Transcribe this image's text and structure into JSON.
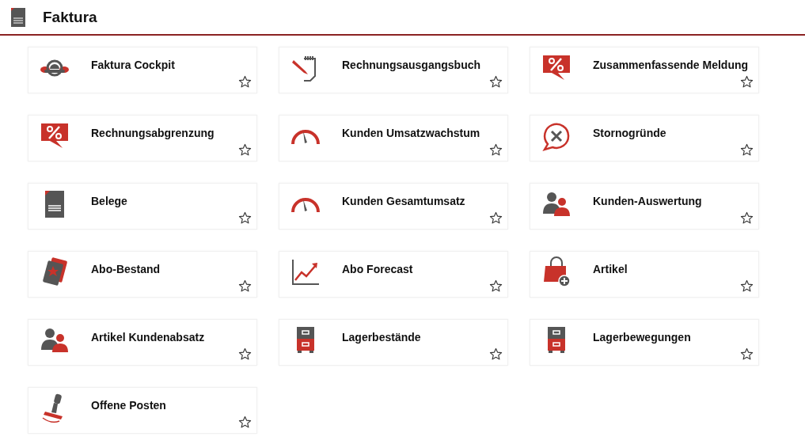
{
  "header": {
    "title": "Faktura"
  },
  "tiles": [
    {
      "label": "Faktura Cockpit",
      "kind": "cockpit"
    },
    {
      "label": "Rechnungsausgangsbuch",
      "kind": "notebook"
    },
    {
      "label": "Zusammenfassende Meldung",
      "kind": "percent"
    },
    {
      "label": "Rechnungsabgrenzung",
      "kind": "percent"
    },
    {
      "label": "Kunden Umsatzwachstum",
      "kind": "gauge"
    },
    {
      "label": "Stornogründe",
      "kind": "cancel"
    },
    {
      "label": "Belege",
      "kind": "document"
    },
    {
      "label": "Kunden Gesamtumsatz",
      "kind": "gauge"
    },
    {
      "label": "Kunden-Auswertung",
      "kind": "users"
    },
    {
      "label": "Abo-Bestand",
      "kind": "card"
    },
    {
      "label": "Abo Forecast",
      "kind": "chart"
    },
    {
      "label": "Artikel",
      "kind": "bag"
    },
    {
      "label": "Artikel Kundenabsatz",
      "kind": "users"
    },
    {
      "label": "Lagerbestände",
      "kind": "cabinet"
    },
    {
      "label": "Lagerbewegungen",
      "kind": "cabinet"
    },
    {
      "label": "Offene Posten",
      "kind": "stamp"
    }
  ]
}
